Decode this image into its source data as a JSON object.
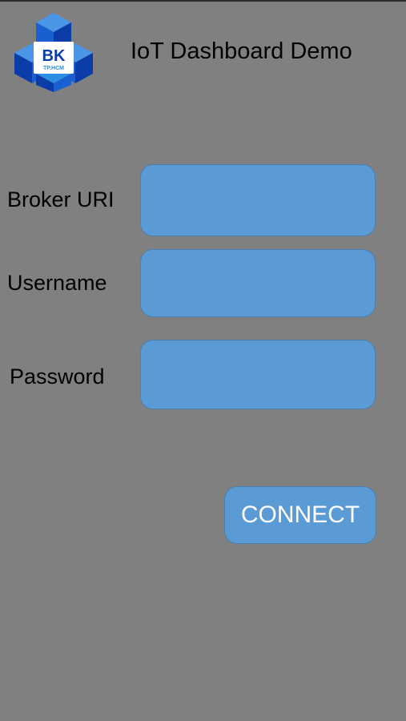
{
  "header": {
    "title": "IoT Dashboard Demo",
    "logo": {
      "icon": "bk-university-logo",
      "text": "BK",
      "subtext": "TP.HCM"
    }
  },
  "form": {
    "broker_uri": {
      "label": "Broker URI",
      "value": "",
      "placeholder": ""
    },
    "username": {
      "label": "Username",
      "value": "",
      "placeholder": ""
    },
    "password": {
      "label": "Password",
      "value": "",
      "placeholder": ""
    },
    "connect_label": "CONNECT"
  },
  "colors": {
    "background": "#808080",
    "field": "#5b9bd5",
    "logo_dark": "#0b3ca8",
    "logo_light": "#2a8fe0"
  }
}
